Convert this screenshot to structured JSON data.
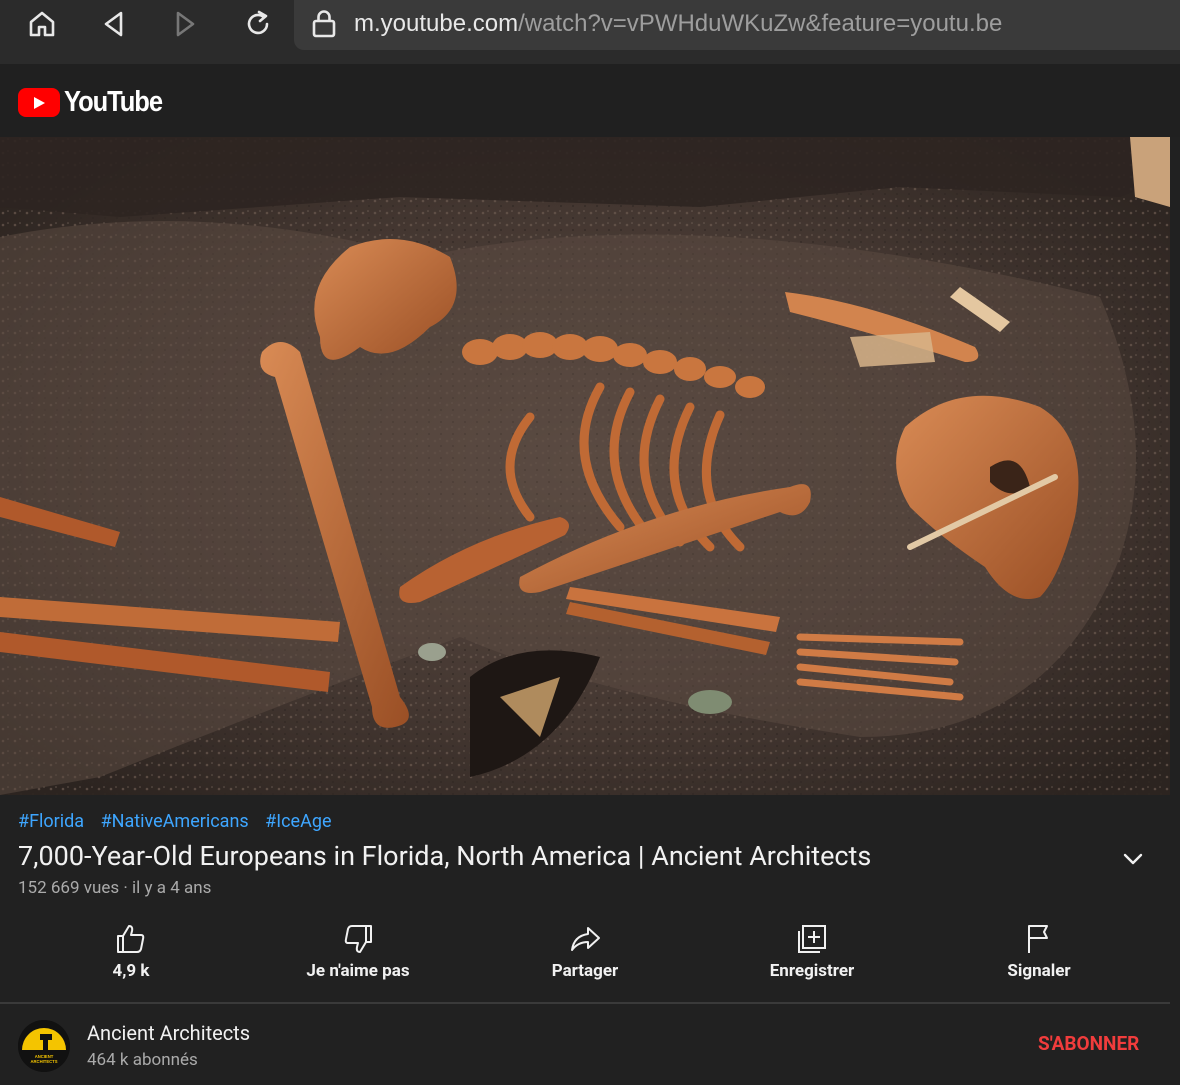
{
  "browser": {
    "url_host": "m.youtube.com",
    "url_path": "/watch?v=vPWHduWKuZw&feature=youtu.be"
  },
  "header": {
    "logo_text": "YouTube"
  },
  "video": {
    "hashtags": [
      "#Florida",
      "#NativeAmericans",
      "#IceAge"
    ],
    "title": "7,000-Year-Old Europeans in Florida, North America | Ancient Architects",
    "meta": "152 669 vues · il y a 4 ans"
  },
  "actions": [
    {
      "label": "4,9 k",
      "icon": "thumbs-up-icon"
    },
    {
      "label": "Je n'aime pas",
      "icon": "thumbs-down-icon"
    },
    {
      "label": "Partager",
      "icon": "share-icon"
    },
    {
      "label": "Enregistrer",
      "icon": "add-to-playlist-icon"
    },
    {
      "label": "Signaler",
      "icon": "flag-icon"
    }
  ],
  "channel": {
    "name": "Ancient Architects",
    "subscribers": "464 k abonnés",
    "subscribe_label": "S'ABONNER",
    "avatar_text": "ANCIENT ARCHITECTS"
  },
  "colors": {
    "background": "#212121",
    "link": "#3ea6ff",
    "subscribe": "#f13c3c",
    "youtube_red": "#ff0000"
  }
}
